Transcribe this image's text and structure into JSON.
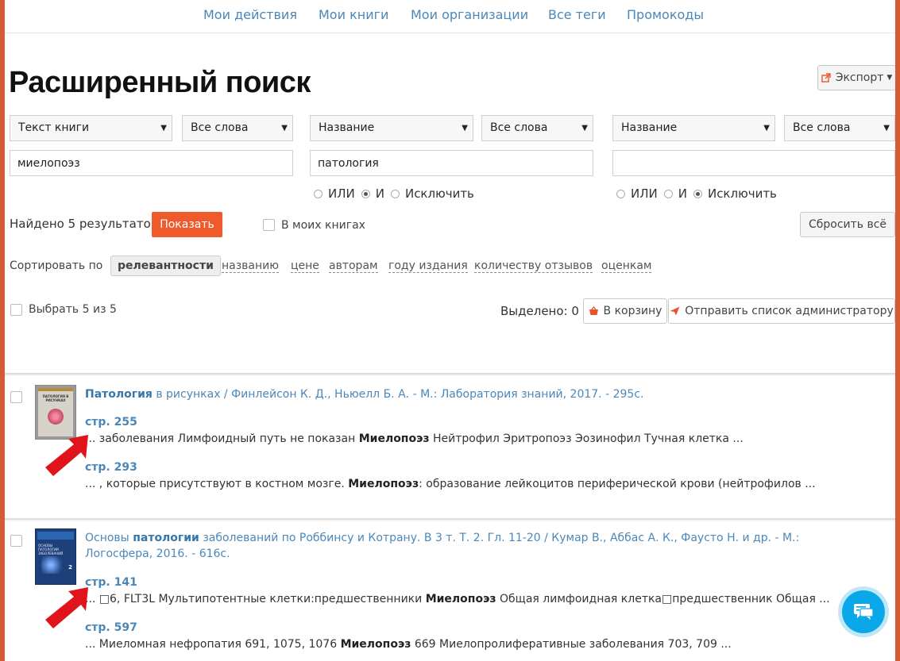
{
  "nav": {
    "items": [
      "Мои действия",
      "Мои книги",
      "Мои организации",
      "Все теги",
      "Промокоды"
    ]
  },
  "page_title": "Расширенный поиск",
  "export_label": "Экспорт",
  "search": {
    "groups": [
      {
        "field": "Текст книги",
        "mode": "Все слова",
        "value": "миелопоэз"
      },
      {
        "field": "Название",
        "mode": "Все слова",
        "value": "патология"
      },
      {
        "field": "Название",
        "mode": "Все слова",
        "value": ""
      }
    ],
    "logic_options": [
      "ИЛИ",
      "И",
      "Исключить"
    ],
    "logic_selected": [
      "И",
      "Исключить"
    ]
  },
  "found_text": "Найдено 5 результатов",
  "show_button": "Показать",
  "in_my_books": "В моих книгах",
  "reset_button": "Сбросить всё",
  "sort": {
    "label": "Сортировать по",
    "active": "релевантности",
    "options": [
      "названию",
      "цене",
      "авторам",
      "году издания",
      "количеству отзывов",
      "оценкам"
    ]
  },
  "select_all": "Выбрать 5 из 5",
  "selected_count": "Выделено: 0",
  "to_cart": "В корзину",
  "send_admin": "Отправить список администратору",
  "results": [
    {
      "title_bold": "Патология",
      "title_rest": " в рисунках / Финлейсон К. Д., Ньюелл Б. А. - М.: Лаборатория знаний, 2017. - 295с.",
      "cover_text": "ПАТОЛОГИЯ В РИСУНКАХ",
      "hits": [
        {
          "page": "стр. 255",
          "before": "... заболевания Лимфоидный путь не показан ",
          "bold": "Миелопоэз",
          "after": " Нейтрофил Эритропоэз Эозинофил Тучная клетка ..."
        },
        {
          "page": "стр. 293",
          "before": "... , которые присутствуют в костном мозге. ",
          "bold": "Миелопоэз",
          "after": ": образование лейкоцитов периферической крови (нейтрофилов ..."
        }
      ]
    },
    {
      "title_pre": "Основы ",
      "title_bold": "патологии",
      "title_rest": " заболеваний по Роббинсу и Котрану. В 3 т. Т. 2. Гл. 11-20 / Кумар В., Аббас А. К., Фаусто Н. и др. - М.: Логосфера, 2016. - 616с.",
      "cover_text": "ОСНОВЫ ПАТОЛОГИИ ЗАБОЛЕВАНИЙ",
      "hits": [
        {
          "page": "стр. 141",
          "before": "... □6, FLT3L Мультипотентные клетки:предшественники ",
          "bold": "Миелопоэз",
          "after": " Общая лимфоидная клетка□предшественник Общая ..."
        },
        {
          "page": "стр. 597",
          "before": "... Миеломная нефропатия 691, 1075, 1076 ",
          "bold": "Миелопоэз",
          "after": " 669 Миелопролиферативные заболевания 703, 709 ..."
        }
      ]
    }
  ],
  "colors": {
    "accent": "#ee5a2b",
    "link": "#4b87b8",
    "annotation_arrow": "#e0141b",
    "chat": "#0aa8e8"
  }
}
